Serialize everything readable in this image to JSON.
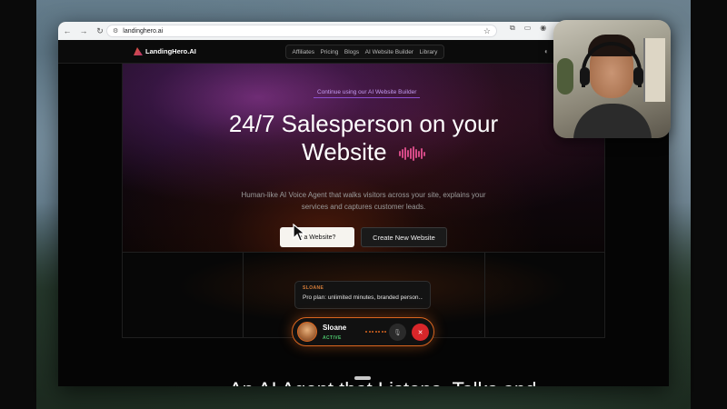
{
  "browser": {
    "url": "landinghero.ai"
  },
  "site": {
    "logo_text": "LandingHero.AI",
    "nav": [
      "Affiliates",
      "Pricing",
      "Blogs",
      "AI Website Builder",
      "Library"
    ],
    "badge": "Continue using our AI Website Builder",
    "headline_line1": "24/7 Salesperson on your",
    "headline_line2": "Website",
    "subtext": "Human-like AI Voice Agent that walks visitors across your site, explains your services and captures customer leads.",
    "primary_button": "e a Website?",
    "secondary_button": "Create New Website",
    "chat": {
      "speaker": "SLOANE",
      "message": "Pro plan: unlimited minutes, branded person..."
    },
    "call": {
      "name": "Sloane",
      "status": "ACTIVE"
    },
    "bottom_heading": "An AI Agent that Listens, Talks and"
  },
  "colors": {
    "accent_orange": "#d9651f",
    "accent_pink": "#d44a86",
    "end_call_red": "#d8262a",
    "status_green": "#4cc46c"
  }
}
